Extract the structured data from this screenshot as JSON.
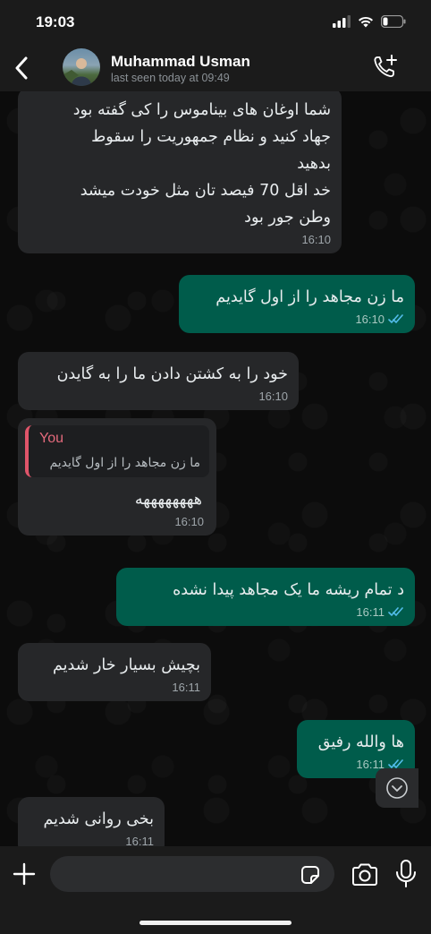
{
  "status_bar": {
    "time": "19:03"
  },
  "header": {
    "contact_name": "Muhammad Usman",
    "contact_status": "last seen today at 09:49",
    "back_icon": "chevron-left-icon",
    "call_icon": "add-call-icon"
  },
  "colors": {
    "incoming_bubble": "#262729",
    "outgoing_bubble": "#005c4b",
    "read_ticks": "#53bdeb",
    "quote_accent": "#e0556a"
  },
  "messages": [
    {
      "direction": "incoming",
      "lines": [
        "شما اوغان های بیناموس را کی گفته بود",
        "جهاد کنید و نظام جمهوریت را سقوط",
        "بدهید",
        "خد اقل 70 فیصد تان مثل خودت میشد",
        "وطن جور بود"
      ],
      "time": "16:10"
    },
    {
      "direction": "outgoing",
      "lines": [
        "ما زن مجاهد را از اول گایدیم"
      ],
      "time": "16:10",
      "read": true
    },
    {
      "direction": "incoming",
      "lines": [
        "خود را به کشتن دادن ما را به گایدن"
      ],
      "time": "16:10"
    },
    {
      "direction": "incoming",
      "quote_author": "You",
      "quote_text": "ما زن مجاهد را از اول گایدیم",
      "lines": [
        "ههههههههه"
      ],
      "time": "16:10"
    },
    {
      "direction": "outgoing",
      "lines": [
        "د تمام ریشه ما یک مجاهد پیدا نشده"
      ],
      "time": "16:11",
      "read": true
    },
    {
      "direction": "incoming",
      "lines": [
        "بچیش بسیار خار شدیم"
      ],
      "time": "16:11"
    },
    {
      "direction": "outgoing",
      "lines": [
        "ها والله رفیق"
      ],
      "time": "16:11",
      "read": true
    },
    {
      "direction": "incoming",
      "lines": [
        "بخی روانی شدیم"
      ],
      "time": "16:11"
    }
  ],
  "input": {
    "placeholder": ""
  }
}
